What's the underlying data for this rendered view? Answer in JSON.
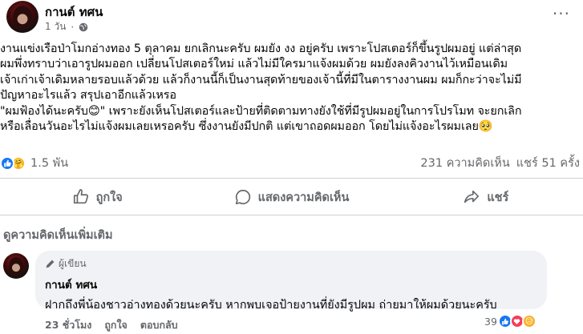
{
  "post": {
    "author": "กานต์ ทศน",
    "time": "1 วัน",
    "more": "···",
    "text": "งานแข่งเรือป่าโมกอ่างทอง 5 ตุลาคม ยกเลิกนะครับ ผมยัง งง อยู่ครับ เพราะโปสเตอร์ก็ขึ้นรูปผมอยู่ แต่ล่าสุด\nผมพึ่งทราบว่าเอารูปผมออก เปลี่ยนโปสเตอร์ใหม่ แล้วไม่มีใครมาแจ้งผมด้วย ผมยังลงคิวงานไว้เหมือนเดิม\nเจ้าเก่าเจ้าเดิมหลายรอบแล้วด้วย แล้วก็งานนี้ก็เป็นงานสุดท้ายของเจ้านี้ที่มีในตารางงานผม ผมก็กะว่าจะไม่มี\nปัญหาอะไรแล้ว สรุปเอาอีกแล้วเหรอ\n\"ผมฟ้องได้นะครับ😊\" เพราะยังเห็นโปสเตอร์และป้ายที่ติดตามทางยังใช้ที่มีรูปผมอยู่ในการโปรโมท จะยกเลิก\nหรือเลื่อนวันอะไรไม่แจ้งผมเลยเหรอครับ ซึ่งงานยังมีปกติ แต่เขาถอดผมออก โดยไม่แจ้งอะไรผมเลย🥺"
  },
  "stats": {
    "reactions_count": "1.5 พัน",
    "comments": "231 ความคิดเห็น",
    "shares": "แชร์ 51 ครั้ง"
  },
  "actions": {
    "like": "ถูกใจ",
    "comment": "แสดงความคิดเห็น",
    "share": "แชร์"
  },
  "more_comments": "ดูความคิดเห็นเพิ่มเติม",
  "comment": {
    "badge": "ผู้เขียน",
    "author": "กานต์ ทศน",
    "text": "ฝากถึงพี่น้องชาวอ่างทองด้วยนะครับ หากพบเจอป้ายงานที่ยังมีรูปผม ถ่ายมาให้ผมด้วยนะครับ",
    "time": "23 ชั่วโมง",
    "like": "ถูกใจ",
    "reply": "ตอบกลับ",
    "reactions_count": "39"
  },
  "colors": {
    "like_blue": "#1877f2",
    "secondary_text": "#65676b",
    "bubble_bg": "#f0f2f5"
  }
}
